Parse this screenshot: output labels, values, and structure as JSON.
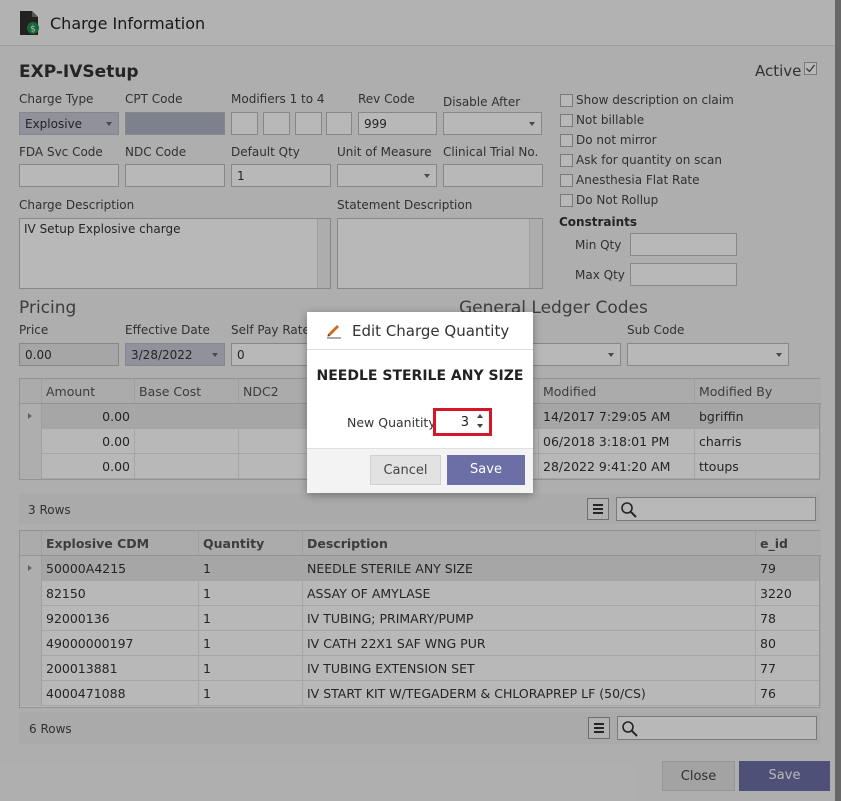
{
  "window": {
    "title": "Charge Information"
  },
  "record": {
    "code": "EXP-IVSetup",
    "active_label": "Active",
    "active": true
  },
  "form": {
    "charge_type_label": "Charge Type",
    "charge_type_value": "Explosive",
    "cpt_code_label": "CPT Code",
    "cpt_code_value": "",
    "modifiers_label": "Modifiers 1 to 4",
    "rev_code_label": "Rev Code",
    "rev_code_value": "999",
    "disable_after_label": "Disable After",
    "disable_after_value": "",
    "fda_svc_code_label": "FDA Svc Code",
    "fda_svc_code_value": "",
    "ndc_code_label": "NDC Code",
    "ndc_code_value": "",
    "default_qty_label": "Default Qty",
    "default_qty_value": "1",
    "unit_of_measure_label": "Unit of Measure",
    "unit_of_measure_value": "",
    "clinical_trial_label": "Clinical Trial No.",
    "clinical_trial_value": "",
    "charge_description_label": "Charge Description",
    "charge_description_value": "IV Setup Explosive charge",
    "statement_description_label": "Statement Description",
    "statement_description_value": ""
  },
  "options": {
    "items": [
      {
        "label": "Show description on claim",
        "checked": false
      },
      {
        "label": "Not billable",
        "checked": false
      },
      {
        "label": "Do not mirror",
        "checked": false
      },
      {
        "label": "Ask for quantity on scan",
        "checked": false
      },
      {
        "label": "Anesthesia Flat Rate",
        "checked": false
      },
      {
        "label": "Do Not Rollup",
        "checked": false
      }
    ],
    "constraints_label": "Constraints",
    "min_qty_label": "Min Qty",
    "min_qty_value": "",
    "max_qty_label": "Max Qty",
    "max_qty_value": ""
  },
  "pricing": {
    "section_title": "Pricing",
    "price_label": "Price",
    "price_value": "0.00",
    "effective_date_label": "Effective Date",
    "effective_date_value": "3/28/2022",
    "self_pay_rate_label": "Self Pay Rate",
    "self_pay_rate_value": "0"
  },
  "gl": {
    "section_title": "General Ledger Codes",
    "sub_code_label": "Sub Code"
  },
  "price_grid": {
    "columns": [
      "Amount",
      "Base Cost",
      "NDC2",
      "Modified",
      "Modified By"
    ],
    "rows": [
      {
        "amount": "0.00",
        "modified": "14/2017 7:29:05 AM",
        "modified_by": "bgriffin"
      },
      {
        "amount": "0.00",
        "modified": "06/2018 3:18:01 PM",
        "modified_by": "charris"
      },
      {
        "amount": "0.00",
        "modified": "28/2022 9:41:20 AM",
        "modified_by": "ttoups"
      }
    ],
    "row_count": "3 Rows"
  },
  "cdm_grid": {
    "columns": [
      "Explosive CDM",
      "Quantity",
      "Description",
      "e_id"
    ],
    "rows": [
      {
        "cdm": "50000A4215",
        "qty": "1",
        "desc": "NEEDLE STERILE ANY SIZE",
        "eid": "79"
      },
      {
        "cdm": "82150",
        "qty": "1",
        "desc": "ASSAY OF AMYLASE",
        "eid": "3220"
      },
      {
        "cdm": "92000136",
        "qty": "1",
        "desc": "IV TUBING; PRIMARY/PUMP",
        "eid": "78"
      },
      {
        "cdm": "49000000197",
        "qty": "1",
        "desc": "IV CATH 22X1 SAF WNG PUR",
        "eid": "80"
      },
      {
        "cdm": "200013881",
        "qty": "1",
        "desc": "IV TUBING EXTENSION SET",
        "eid": "77"
      },
      {
        "cdm": "4000471088",
        "qty": "1",
        "desc": "IV START KIT W/TEGADERM & CHLORAPREP LF (50/CS)",
        "eid": "76"
      }
    ],
    "row_count": "6 Rows"
  },
  "footer": {
    "close_label": "Close",
    "save_label": "Save"
  },
  "modal": {
    "title": "Edit Charge Quantity",
    "item_name": "NEEDLE STERILE ANY SIZE",
    "qty_label": "New Quanitity",
    "qty_value": "3",
    "cancel_label": "Cancel",
    "save_label": "Save"
  },
  "colors": {
    "accent": "#6c6fa6",
    "highlight": "#d6172a",
    "pencil": "#d2691e"
  },
  "icons": [
    "document-dollar-icon",
    "pencil-icon",
    "menu-icon",
    "search-icon",
    "checkbox-checked-icon"
  ]
}
